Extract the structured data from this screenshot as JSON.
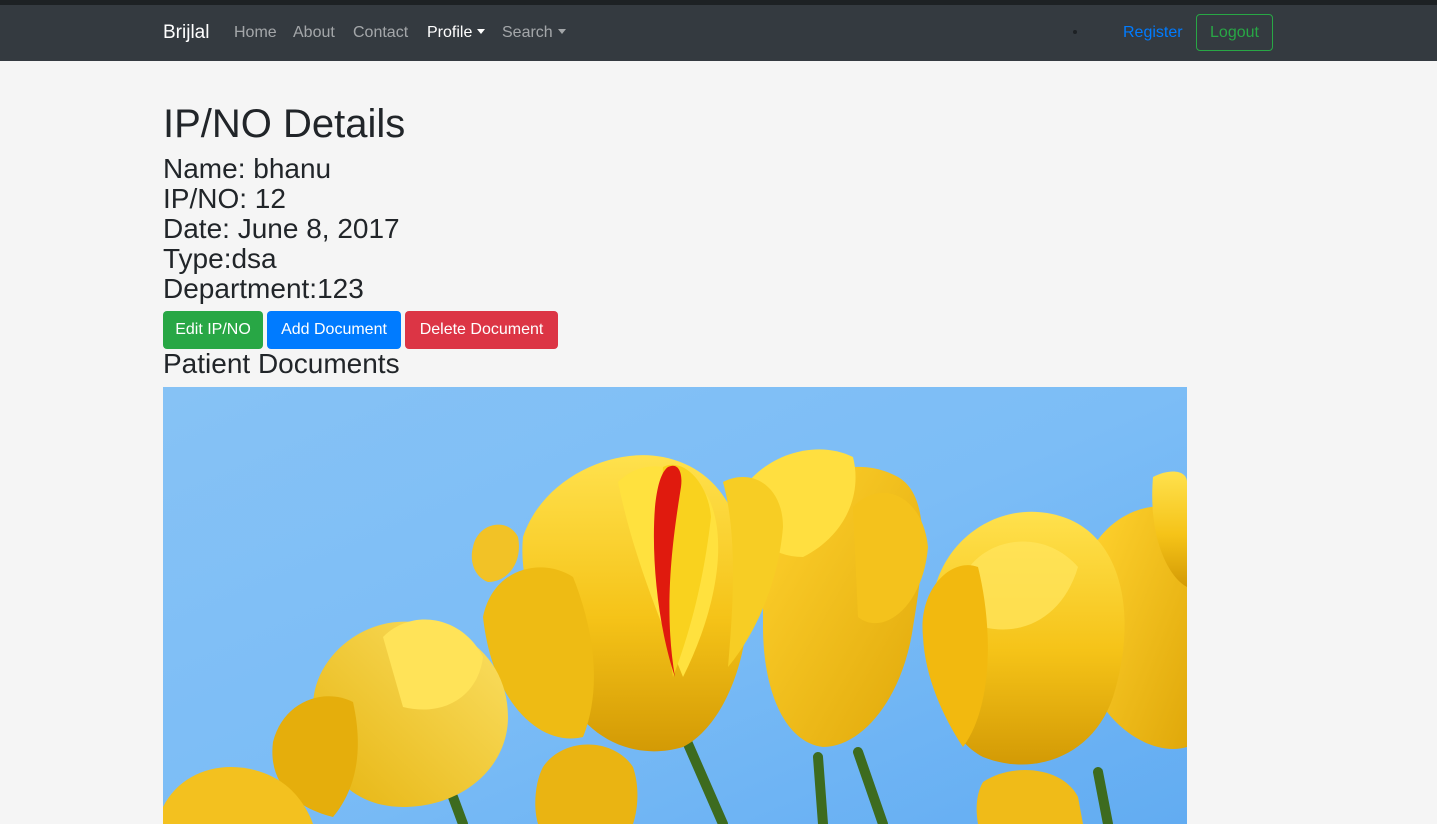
{
  "navbar": {
    "brand": "Brijlal",
    "links": [
      {
        "label": "Home"
      },
      {
        "label": "About"
      },
      {
        "label": "Contact"
      },
      {
        "label": "Profile"
      },
      {
        "label": "Search"
      }
    ],
    "register_label": "Register",
    "logout_label": "Logout"
  },
  "page": {
    "title": "IP/NO Details",
    "details": {
      "name": "Name: bhanu",
      "ipno": "IP/NO: 12",
      "date": "Date: June 8, 2017",
      "type": "Type:dsa",
      "department": "Department:123"
    },
    "buttons": {
      "edit": "Edit IP/NO",
      "add": "Add Document",
      "delete": "Delete Document"
    },
    "documents_title": "Patient Documents"
  },
  "colors": {
    "navbar_bg": "#343a40",
    "page_bg": "#f5f5f5",
    "success": "#28a745",
    "primary": "#007bff",
    "danger": "#dc3545"
  },
  "icons": {
    "dropdown": "caret-down-icon"
  }
}
